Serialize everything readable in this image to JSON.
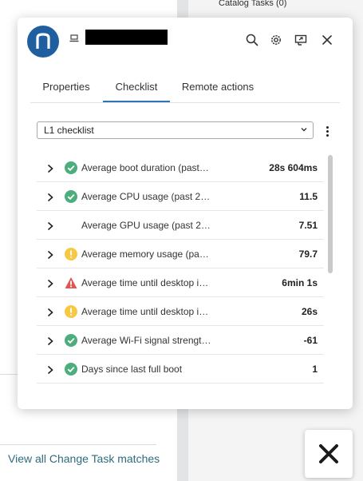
{
  "background": {
    "catalog_tasks": "Catalog Tasks (0)",
    "view_all_link": "View all Change Task matches"
  },
  "header": {
    "logo_letter": "n",
    "device_name_redacted": true
  },
  "tabs": [
    {
      "label": "Properties",
      "active": false
    },
    {
      "label": "Checklist",
      "active": true
    },
    {
      "label": "Remote actions",
      "active": false
    }
  ],
  "checklist_select": {
    "value": "L1 checklist"
  },
  "checklist": [
    {
      "label": "Average boot duration (past…",
      "value": "28s 604ms",
      "status": "ok"
    },
    {
      "label": "Average CPU usage (past 2…",
      "value": "11.5",
      "status": "ok"
    },
    {
      "label": "Average GPU usage (past 2…",
      "value": "7.51",
      "status": "none"
    },
    {
      "label": "Average memory usage (pa…",
      "value": "79.7",
      "status": "warning"
    },
    {
      "label": "Average time until desktop i…",
      "value": "6min 1s",
      "status": "error"
    },
    {
      "label": "Average time until desktop i…",
      "value": "26s",
      "status": "warning"
    },
    {
      "label": "Average Wi-Fi signal strengt…",
      "value": "-61",
      "status": "ok"
    },
    {
      "label": "Days since last full boot",
      "value": "1",
      "status": "ok"
    }
  ],
  "colors": {
    "accent": "#2f74b5",
    "logo": "#1f5fa0",
    "ok": "#4cae7d",
    "warning": "#f7c843",
    "error": "#e0574f",
    "link": "#2d6c7c"
  }
}
